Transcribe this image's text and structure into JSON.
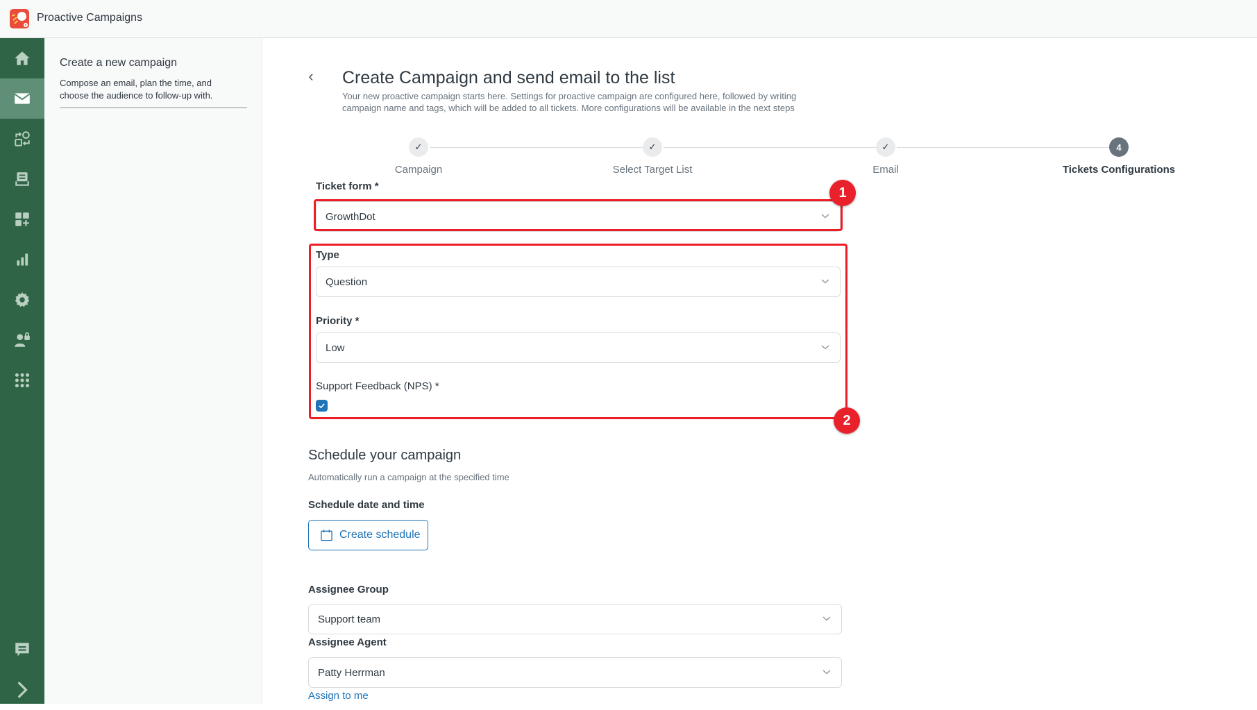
{
  "app": {
    "title": "Proactive Campaigns"
  },
  "sidebar": {
    "items": [
      {
        "name": "home",
        "icon": "home-icon",
        "active": false
      },
      {
        "name": "campaigns",
        "icon": "mail-icon",
        "active": true
      },
      {
        "name": "automations",
        "icon": "workflow-icon",
        "active": false
      },
      {
        "name": "inbox",
        "icon": "inbox-icon",
        "active": false
      },
      {
        "name": "apps",
        "icon": "add-widget-icon",
        "active": false
      },
      {
        "name": "reports",
        "icon": "bar-chart-icon",
        "active": false
      },
      {
        "name": "settings",
        "icon": "gear-icon",
        "active": false
      },
      {
        "name": "permissions",
        "icon": "user-lock-icon",
        "active": false
      },
      {
        "name": "more",
        "icon": "grid-dots-icon",
        "active": false
      }
    ],
    "bottom_items": [
      {
        "name": "feedback",
        "icon": "chat-icon"
      },
      {
        "name": "expand",
        "icon": "chevron-right-icon"
      }
    ],
    "colors": {
      "background": "#2f6446",
      "active": "#5f8f76",
      "icon": "#b9cfc1"
    }
  },
  "subpanel": {
    "title": "Create a new campaign",
    "description": "Compose an email, plan the time, and choose the audience to follow-up with."
  },
  "page": {
    "back_icon": "‹",
    "title": "Create Campaign and send email to the list",
    "description": "Your new proactive campaign starts here. Settings for proactive campaign are configured here, followed by writing campaign name and tags, which will be added to all tickets. More configurations will be available in the next steps"
  },
  "stepper": {
    "steps": [
      {
        "label": "Campaign",
        "status": "done",
        "marker": "✓"
      },
      {
        "label": "Select Target List",
        "status": "done",
        "marker": "✓"
      },
      {
        "label": "Email",
        "status": "done",
        "marker": "✓"
      },
      {
        "label": "Tickets Configurations",
        "status": "current",
        "marker": "4"
      }
    ]
  },
  "form": {
    "ticket_form": {
      "label": "Ticket form *",
      "value": "GrowthDot"
    },
    "type": {
      "label": "Type",
      "value": "Question"
    },
    "priority": {
      "label": "Priority *",
      "value": "Low"
    },
    "nps": {
      "label": "Support Feedback (NPS) *",
      "checked": true
    }
  },
  "annotations": [
    {
      "number": "1",
      "color": "#ee1c25"
    },
    {
      "number": "2",
      "color": "#ee1c25"
    }
  ],
  "schedule": {
    "title": "Schedule your campaign",
    "description": "Automatically run a campaign at the specified time",
    "date_label": "Schedule date and time",
    "button_label": "Create schedule"
  },
  "assignee": {
    "group": {
      "label": "Assignee Group",
      "value": "Support team"
    },
    "agent": {
      "label": "Assignee Agent",
      "value": "Patty Herrman"
    },
    "assign_to_me": "Assign to me"
  },
  "colors": {
    "accent": "#1f73b7",
    "text": "#2f3941",
    "muted": "#68737d"
  }
}
